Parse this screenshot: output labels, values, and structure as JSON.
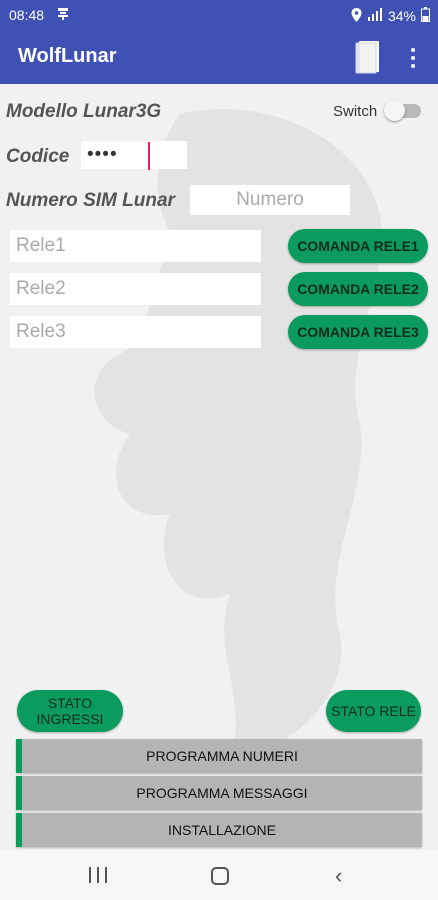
{
  "status_bar": {
    "time": "08:48",
    "battery": "34%"
  },
  "app_bar": {
    "title": "WolfLunar"
  },
  "form": {
    "modello_label": "Modello Lunar3G",
    "switch_label": "Switch",
    "switch_on": false,
    "codice_label": "Codice",
    "codice_value": "••••",
    "sim_label": "Numero SIM Lunar",
    "sim_placeholder": "Numero",
    "rele_rows": [
      {
        "placeholder": "Rele1",
        "button": "COMANDA RELE1"
      },
      {
        "placeholder": "Rele2",
        "button": "COMANDA RELE2"
      },
      {
        "placeholder": "Rele3",
        "button": "COMANDA RELE3"
      }
    ]
  },
  "bottom": {
    "stato_ingressi": "STATO INGRESSI",
    "stato_rele": "STATO RELE",
    "menu": [
      "PROGRAMMA NUMERI",
      "PROGRAMMA MESSAGGI",
      "INSTALLAZIONE"
    ]
  },
  "colors": {
    "primary": "#3f51b5",
    "accent_green": "#0b9b5f",
    "cursor": "#e91e63"
  }
}
